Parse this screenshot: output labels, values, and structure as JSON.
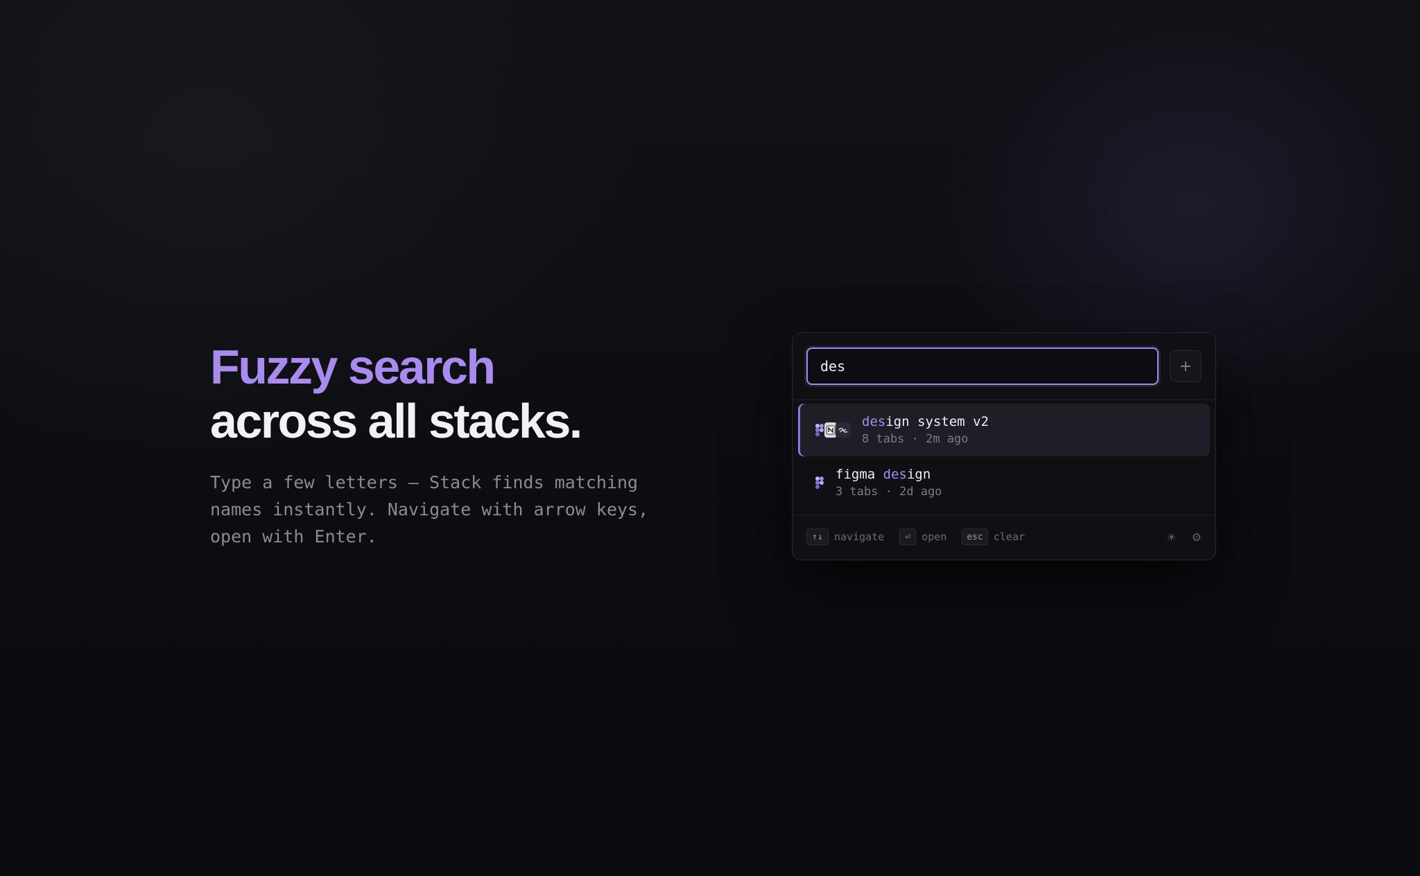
{
  "hero": {
    "headline_accent": "Fuzzy search",
    "headline_main": "across all stacks.",
    "subtitle": "Type a few letters — Stack finds matching names instantly. Navigate with arrow keys, open with Enter."
  },
  "search": {
    "value": "des",
    "add_label": "+"
  },
  "results": [
    {
      "name_match": "des",
      "name_rest": "ign system v2",
      "meta": "8 tabs · 2m ago",
      "icons": [
        "figma-icon",
        "notion-icon",
        "tailwind-icon"
      ],
      "active": true
    },
    {
      "name_prefix": "figma ",
      "name_match": "des",
      "name_rest": "ign",
      "meta": "3 tabs · 2d ago",
      "icons": [
        "figma-icon"
      ],
      "active": false
    }
  ],
  "footer": {
    "navigate_key": "↑↓",
    "navigate_label": "navigate",
    "open_key": "⏎",
    "open_label": "open",
    "clear_key": "esc",
    "clear_label": "clear",
    "theme_icon": "☀",
    "settings_icon": "⚙"
  },
  "colors": {
    "accent": "#a98bf0",
    "background": "#0c0d11"
  }
}
